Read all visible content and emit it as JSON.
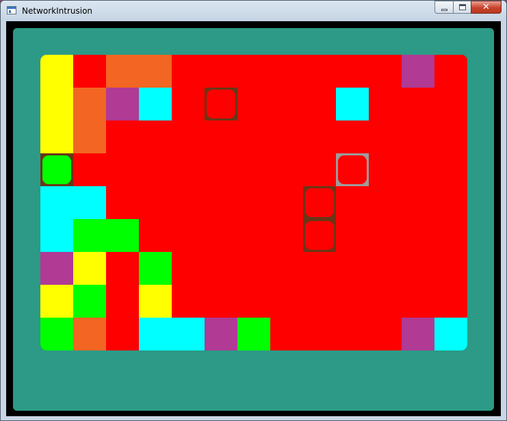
{
  "window": {
    "title": "NetworkIntrusion",
    "minimize_label": "",
    "maximize_label": "",
    "close_label": "✕"
  },
  "colors": {
    "Y": "#ffff00",
    "R": "#ff0000",
    "O": "#f26522",
    "P": "#b03a94",
    "C": "#00ffff",
    "G": "#00ff00",
    "panel": "#2c9a86",
    "selection_border": "#6a3618",
    "selection_border_alt": "#9c9c9c"
  },
  "board": {
    "rows": 9,
    "cols": 13,
    "grid": [
      "YROORRRRRRRPR",
      "YOPCRRRRRCRRR",
      "YORRRRRRRRRRR",
      "GRRRRRRRRRRRR",
      "CCRRRRRRRRRRR",
      "CGGRRRRRRRRRR",
      "PYRGRRRRRRRRR",
      "YGRYRRRRRRRRR",
      "GORCCPGRRRRPC"
    ],
    "highlighted_cells": [
      {
        "row": 1,
        "col": 5,
        "style": "brown"
      },
      {
        "row": 3,
        "col": 0,
        "style": "brown"
      },
      {
        "row": 3,
        "col": 9,
        "style": "gray"
      },
      {
        "row": 4,
        "col": 8,
        "style": "brown"
      },
      {
        "row": 5,
        "col": 8,
        "style": "brown"
      }
    ]
  }
}
